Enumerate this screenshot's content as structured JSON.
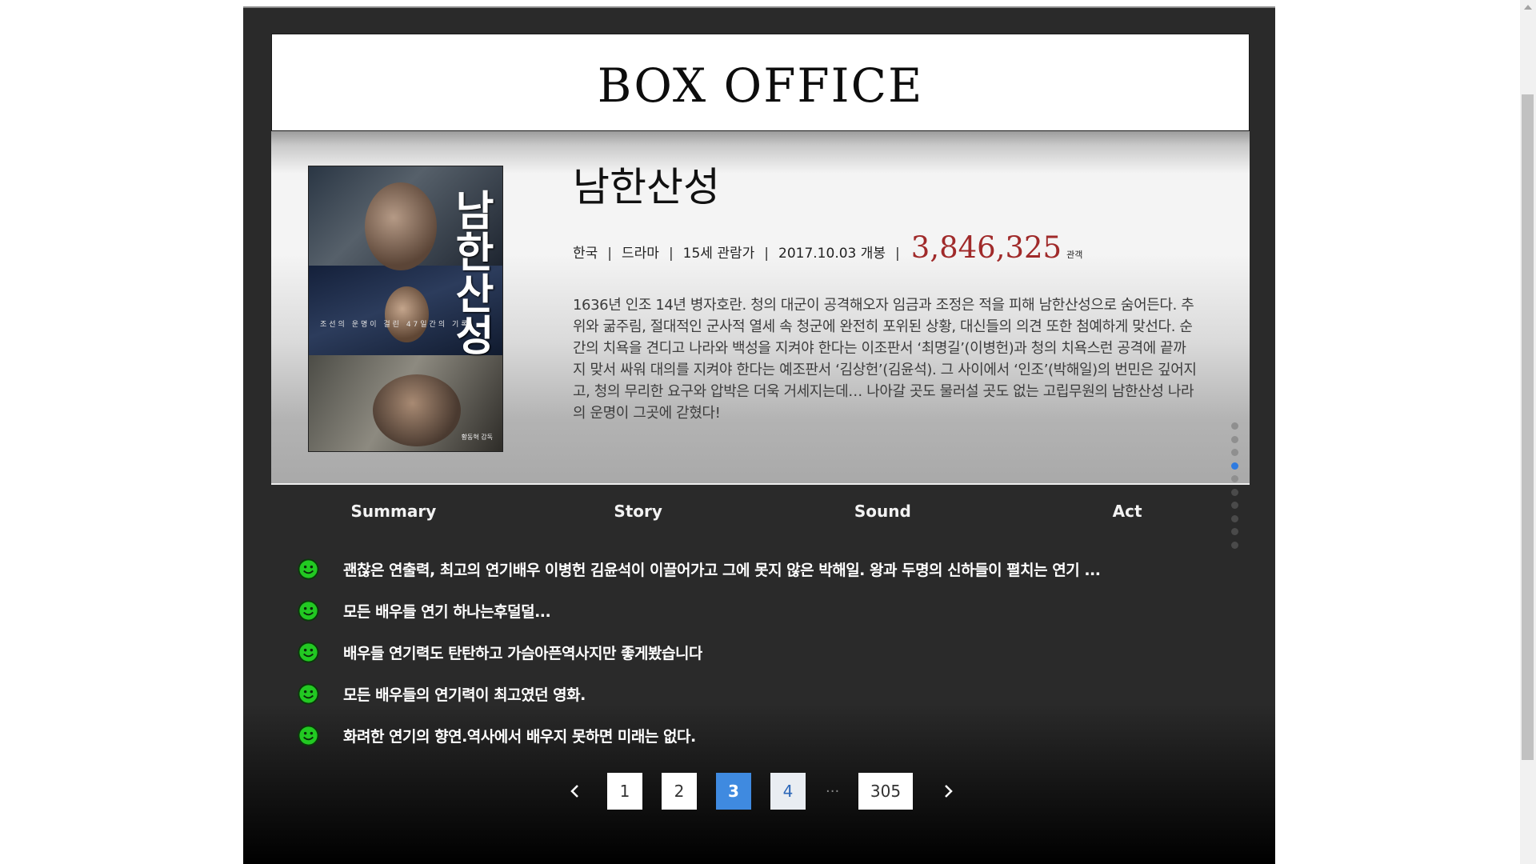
{
  "header": {
    "title": "BOX OFFICE"
  },
  "movie": {
    "title": "남한산성",
    "country": "한국",
    "genre": "드라마",
    "rating": "15세 관람가",
    "release": "2017.10.03 개봉",
    "separator": "|",
    "audience_count": "3,846,325",
    "audience_unit": "관객",
    "synopsis": "1636년 인조 14년 병자호란. 청의 대군이 공격해오자 임금과 조정은 적을 피해 남한산성으로 숨어든다. 추위와 굶주림, 절대적인 군사적 열세 속 청군에 완전히 포위된 상황, 대신들의 의견 또한 첨예하게 맞선다. 순간의 치욕을 견디고 나라와 백성을 지켜야 한다는 이조판서 ‘최명길’(이병헌)과 청의 치욕스런 공격에 끝까지 맞서 싸워 대의를 지켜야 한다는 예조판서 ‘김상헌’(김윤석). 그 사이에서 ‘인조’(박해일)의 번민은 깊어지고, 청의 무리한 요구와 압박은 더욱 거세지는데… 나아갈 곳도 물러설 곳도 없는 고립무원의 남한산성 나라의 운명이 그곳에 갇혔다!",
    "poster": {
      "title": "남한산성",
      "tagline": "조선의 운명이 걸린 47일간의 기록",
      "credit": "황동혁 감독"
    }
  },
  "tabs": [
    "Summary",
    "Story",
    "Sound",
    "Act"
  ],
  "reviews": [
    {
      "text": "괜찮은 연출력, 최고의 연기배우 이병헌 김윤석이 이끌어가고 그에 못지 않은 박해일. 왕과 두명의 신하들이 펼치는 연기 ...",
      "icon": "smiley-icon"
    },
    {
      "text": "모든 배우들 연기 하나는후덜덜...",
      "icon": "smiley-icon"
    },
    {
      "text": "배우들 연기력도 탄탄하고 가슴아픈역사지만 좋게봤습니다",
      "icon": "smiley-icon"
    },
    {
      "text": "모든 배우들의 연기력이 최고였던 영화.",
      "icon": "smiley-icon"
    },
    {
      "text": "화려한 연기의 향연.역사에서 배우지 못하면 미래는 없다.",
      "icon": "smiley-icon"
    }
  ],
  "pagination": {
    "pages": [
      "1",
      "2",
      "3",
      "4"
    ],
    "ellipsis": "...",
    "last": "305",
    "current": "3"
  },
  "dot_nav": {
    "count": 10,
    "active_index": 3
  },
  "colors": {
    "accent": "#3f8ae0",
    "count_red": "#a02a2a",
    "smiley_green": "#22c922",
    "frame": "#2a2a2a"
  }
}
